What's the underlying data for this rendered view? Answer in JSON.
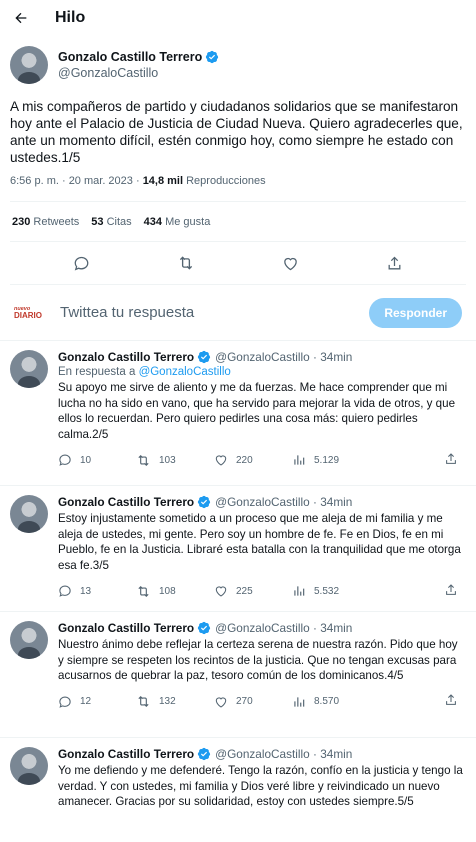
{
  "header": {
    "title": "Hilo"
  },
  "main": {
    "name": "Gonzalo Castillo Terrero",
    "handle": "@GonzaloCastillo",
    "text": "A mis compañeros de partido y ciudadanos solidarios que se manifestaron hoy ante el Palacio de Justicia de Ciudad Nueva. Quiero agradecerles que, ante un momento difícil, estén conmigo hoy, como siempre he estado con ustedes.1/5",
    "time": "6:56 p. m. · 20 mar. 2023 · ",
    "views_count": "14,8 mil",
    "views_label": " Reproducciones",
    "retweets_count": "230",
    "retweets_label": "Retweets",
    "quotes_count": "53",
    "quotes_label": "Citas",
    "likes_count": "434",
    "likes_label": "Me gusta"
  },
  "reply_box": {
    "logo_top": "nuevo",
    "logo_bottom": "DIARIO",
    "placeholder": "Twittea tu respuesta",
    "button": "Responder"
  },
  "thread": [
    {
      "name": "Gonzalo Castillo Terrero",
      "handle": "@GonzaloCastillo · 34min",
      "reply_prefix": "En respuesta a ",
      "reply_to": "@GonzaloCastillo",
      "text": "Su apoyo me sirve de aliento y me da fuerzas. Me hace comprender que mi lucha no ha sido en vano, que ha servido para mejorar la vida de otros, y que ellos lo recuerdan. Pero quiero pedirles una cosa más: quiero pedirles calma.2/5",
      "replies": "10",
      "retweets": "103",
      "likes": "220",
      "views": "5.129"
    },
    {
      "name": "Gonzalo Castillo Terrero",
      "handle": "@GonzaloCastillo · 34min",
      "text": "Estoy injustamente sometido a un proceso que me aleja de mi familia y me aleja de ustedes, mi gente. Pero soy un hombre de fe. Fe en Dios, fe en mi Pueblo, fe en la Justicia. Libraré esta batalla con la tranquilidad que me otorga esa fe.3/5",
      "replies": "13",
      "retweets": "108",
      "likes": "225",
      "views": "5.532"
    },
    {
      "name": "Gonzalo Castillo Terrero",
      "handle": "@GonzaloCastillo · 34min",
      "text": "Nuestro ánimo debe reflejar la certeza serena de nuestra razón. Pido que hoy y siempre se respeten los recintos de la justicia. Que no tengan excusas para acusarnos de quebrar la paz, tesoro común de los dominicanos.4/5",
      "replies": "12",
      "retweets": "132",
      "likes": "270",
      "views": "8.570"
    },
    {
      "name": "Gonzalo Castillo Terrero",
      "handle": "@GonzaloCastillo · 34min",
      "text": "Yo me defiendo y me defenderé. Tengo la razón, confío en la justicia y tengo la verdad. Y con ustedes, mi familia y Dios veré libre y reivindicado un nuevo amanecer. Gracias por su solidaridad, estoy con ustedes siempre.5/5"
    }
  ],
  "icons": {
    "back": "arrow-left-icon",
    "verified": "verified-badge-icon",
    "reply": "reply-icon",
    "retweet": "retweet-icon",
    "like": "heart-icon",
    "views": "views-icon",
    "share": "share-icon"
  },
  "colors": {
    "accent": "#1d9bf0",
    "muted": "#536471",
    "text": "#0f1419",
    "button_disabled": "#8ecdf8"
  }
}
